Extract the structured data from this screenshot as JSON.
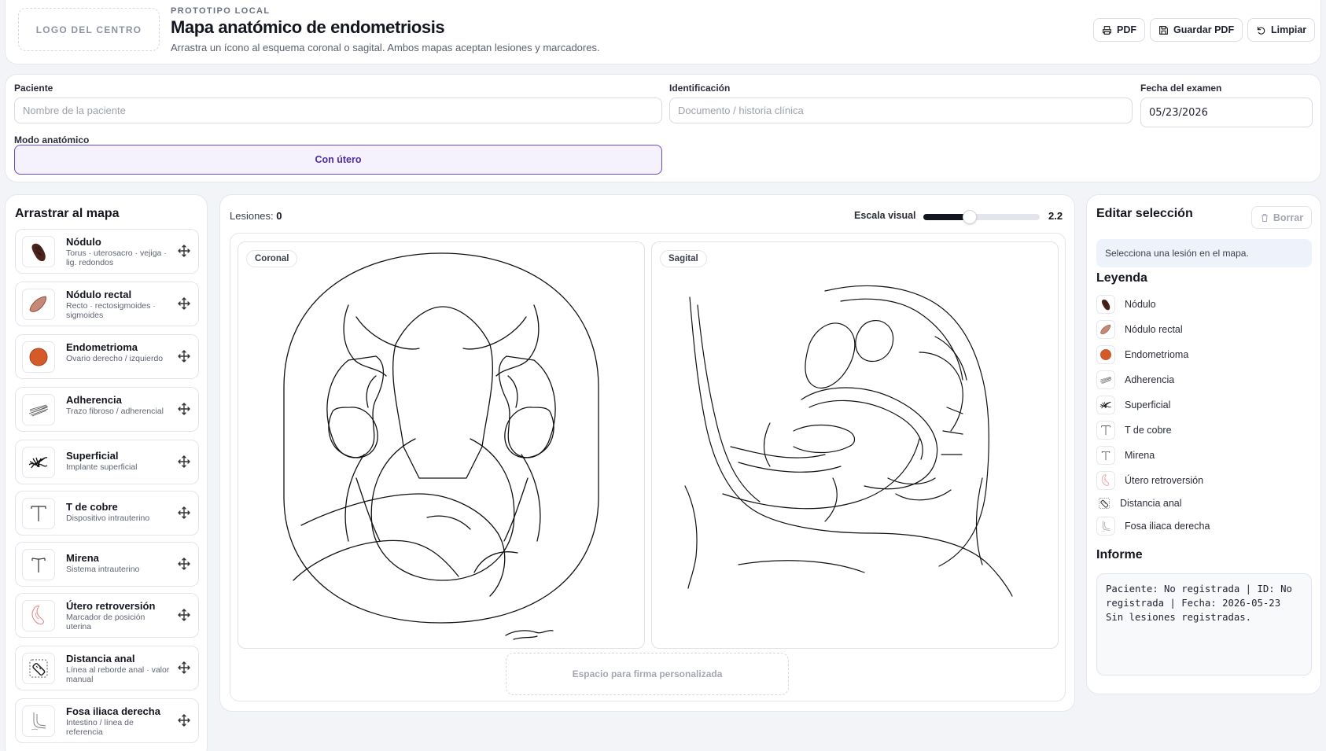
{
  "header": {
    "logo_text": "LOGO DEL CENTRO",
    "eyebrow": "PROTOTIPO LOCAL",
    "title": "Mapa anatómico de endometriosis",
    "subtitle": "Arrastra un ícono al esquema coronal o sagital. Ambos mapas aceptan lesiones y marcadores.",
    "buttons": {
      "pdf": "PDF",
      "save_pdf": "Guardar PDF",
      "clear": "Limpiar"
    }
  },
  "form": {
    "patient_label": "Paciente",
    "patient_placeholder": "Nombre de la paciente",
    "id_label": "Identificación",
    "id_placeholder": "Documento / historia clínica",
    "date_label": "Fecha del examen",
    "date_value": "05/23/2026",
    "mode_label": "Modo anatómico",
    "mode_value": "Con útero"
  },
  "palette": {
    "title": "Arrastrar al mapa",
    "items": [
      {
        "name": "Nódulo",
        "desc": "Torus · uterosacro · vejiga · lig. redondos",
        "icon": "nodule-icon"
      },
      {
        "name": "Nódulo rectal",
        "desc": "Recto · rectosigmoides · sigmoides",
        "icon": "rectal-nodule-icon"
      },
      {
        "name": "Endometrioma",
        "desc": "Ovario derecho / izquierdo",
        "icon": "endometrioma-icon"
      },
      {
        "name": "Adherencia",
        "desc": "Trazo fibroso / adherencial",
        "icon": "adhesion-icon"
      },
      {
        "name": "Superficial",
        "desc": "Implante superficial",
        "icon": "superficial-implant-icon"
      },
      {
        "name": "T de cobre",
        "desc": "Dispositivo intrauterino",
        "icon": "copper-t-icon"
      },
      {
        "name": "Mirena",
        "desc": "Sistema intrauterino",
        "icon": "mirena-icon"
      },
      {
        "name": "Útero retroversión",
        "desc": "Marcador de posición uterina",
        "icon": "retroverted-uterus-icon"
      },
      {
        "name": "Distancia anal",
        "desc": "Línea al reborde anal · valor manual",
        "icon": "anal-distance-icon"
      },
      {
        "name": "Fosa iliaca derecha",
        "desc": "Intestino / línea de referencia",
        "icon": "iliac-fossa-icon"
      }
    ]
  },
  "center": {
    "lesions_label": "Lesiones:",
    "lesions_count": "0",
    "scale_label": "Escala visual",
    "scale_value": "2.2",
    "scale_fraction": 0.4,
    "map_coronal": "Coronal",
    "map_sagittal": "Sagital",
    "signature_placeholder": "Espacio para firma personalizada"
  },
  "right": {
    "edit_title": "Editar selección",
    "delete_label": "Borrar",
    "selection_hint": "Selecciona una lesión en el mapa.",
    "legend_title": "Leyenda",
    "legend": [
      "Nódulo",
      "Nódulo rectal",
      "Endometrioma",
      "Adherencia",
      "Superficial",
      "T de cobre",
      "Mirena",
      "Útero retroversión",
      "Distancia anal",
      "Fosa iliaca derecha"
    ],
    "report_title": "Informe",
    "report_text": "Paciente: No registrada | ID: No registrada | Fecha: 2026-05-23\nSin lesiones registradas."
  },
  "colors": {
    "accent": "#6b4bc4",
    "nodule": "#4a241c",
    "rectal_nodule": "#c88878",
    "endometrioma": "#d45a2a"
  }
}
